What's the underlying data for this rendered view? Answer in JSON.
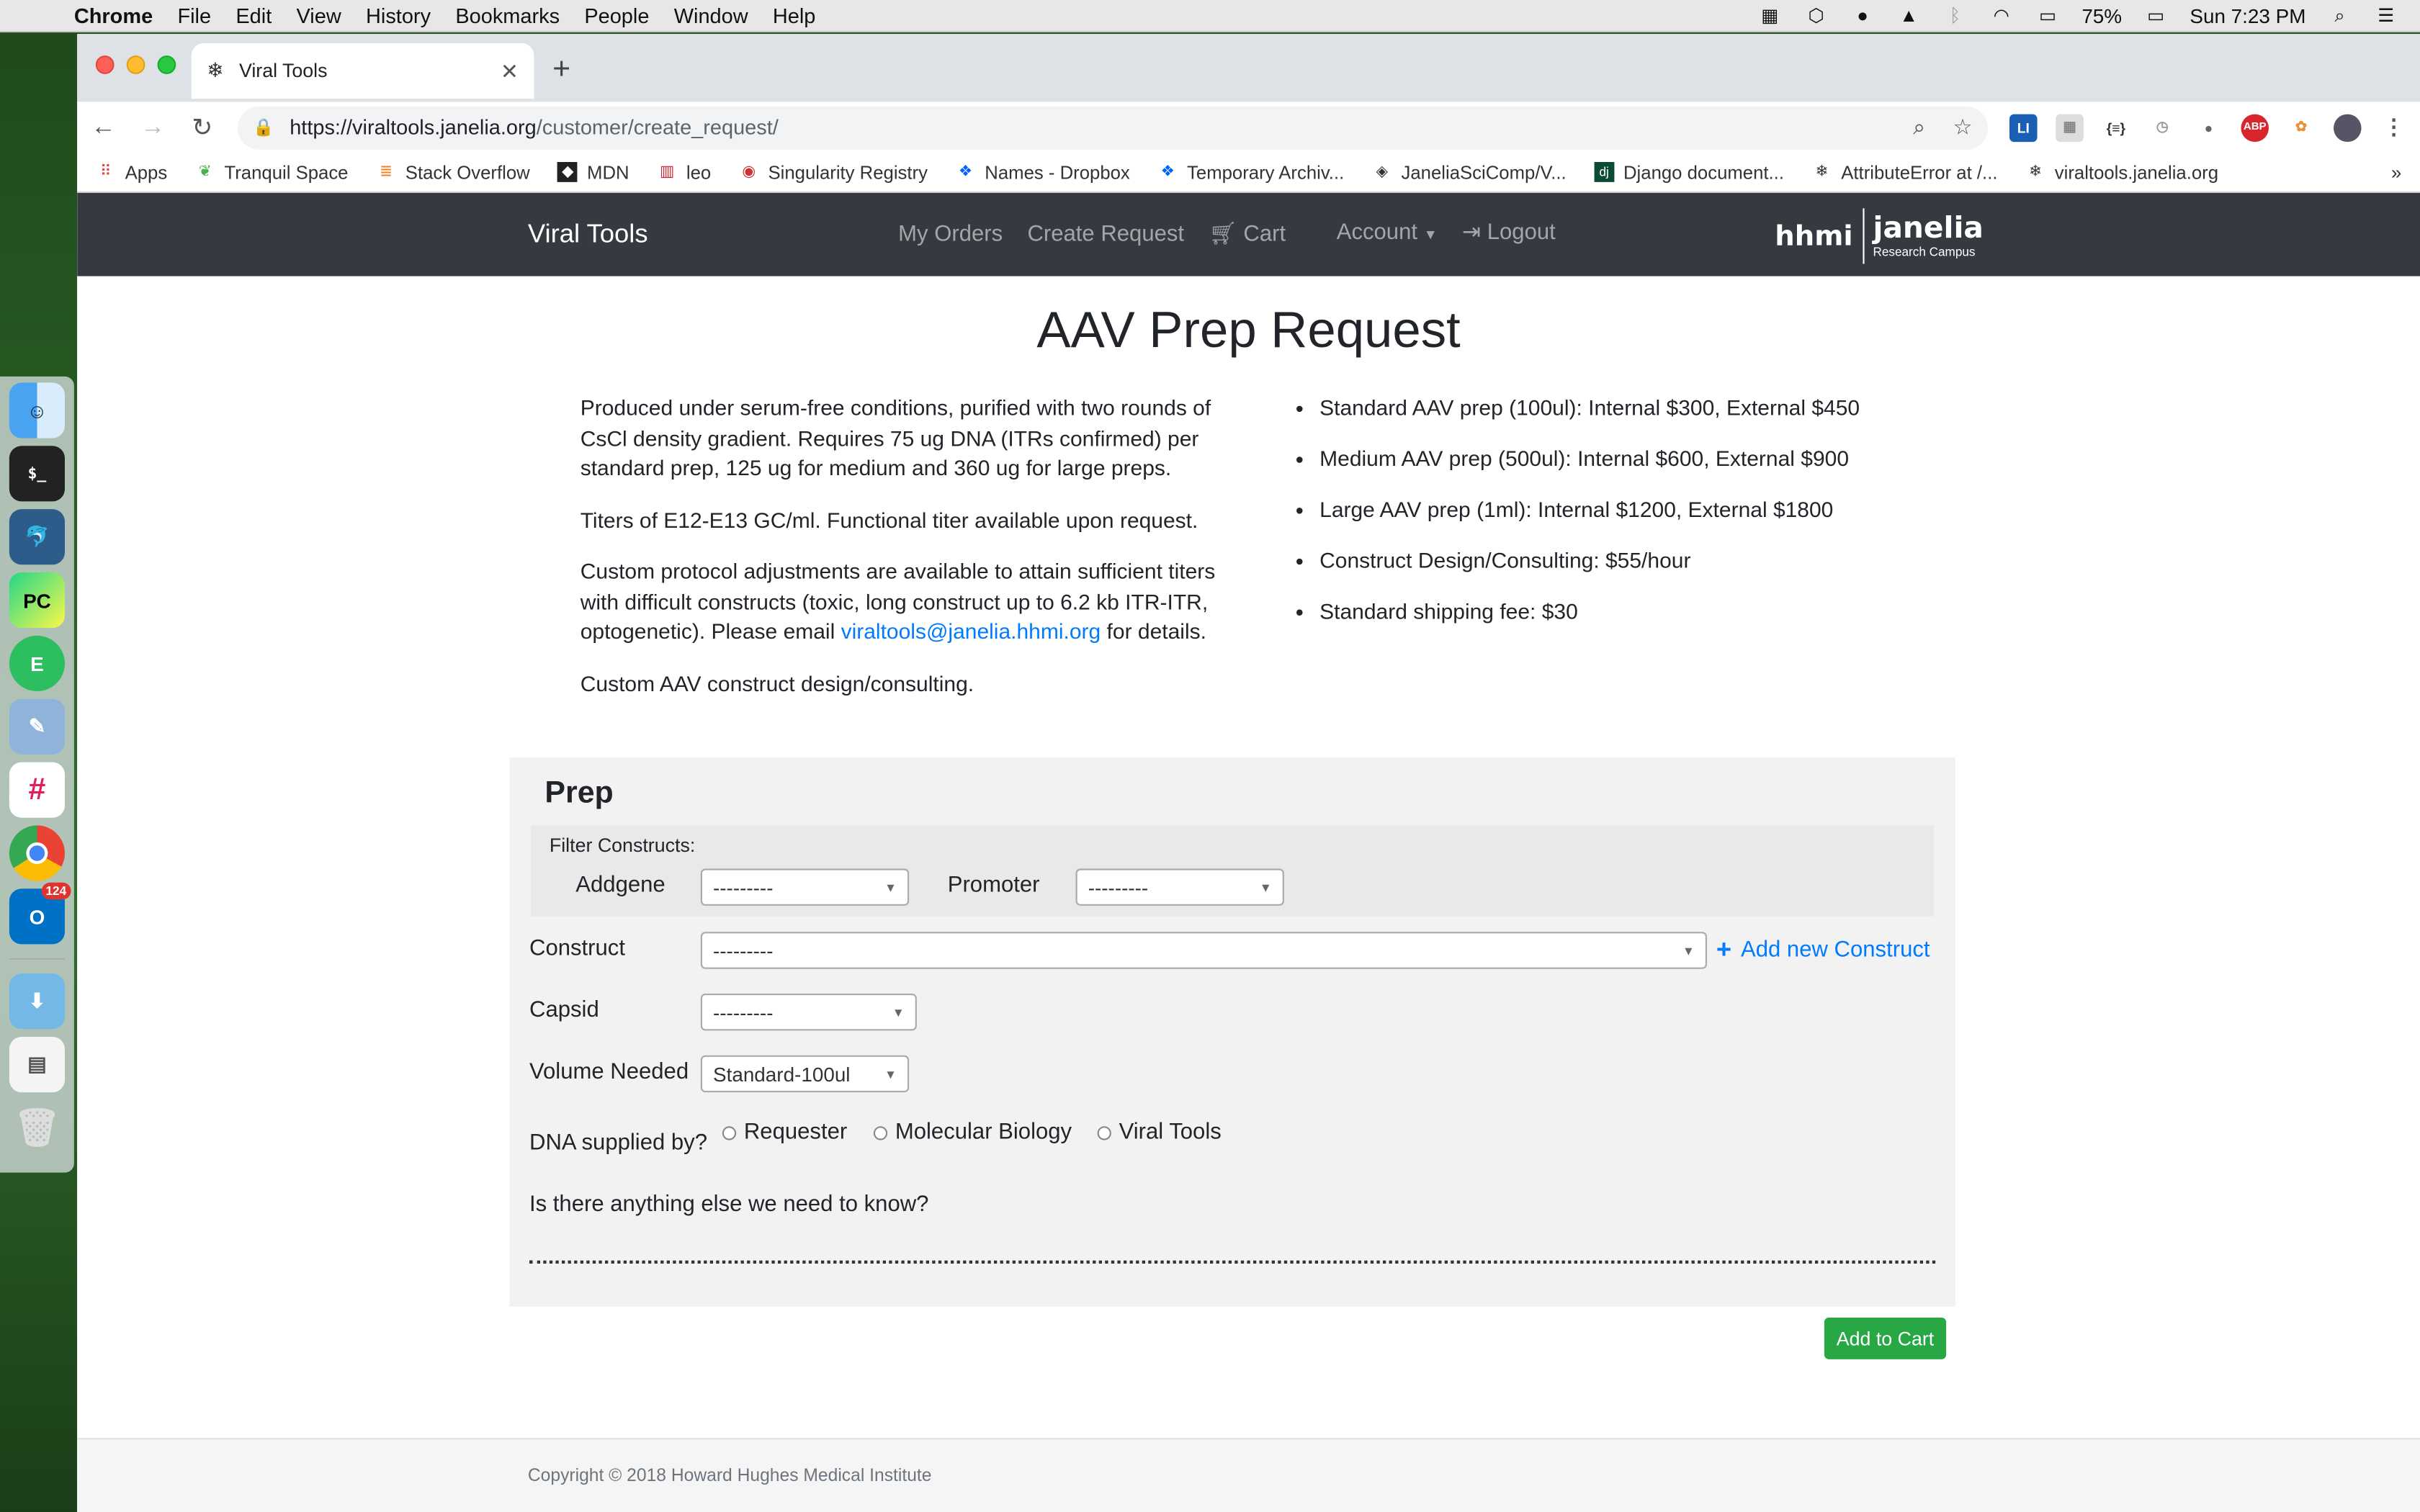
{
  "menubar": {
    "app": "Chrome",
    "items": [
      "File",
      "Edit",
      "View",
      "History",
      "Bookmarks",
      "People",
      "Window",
      "Help"
    ],
    "battery": "75%",
    "clock": "Sun 7:23 PM"
  },
  "dock": {
    "outlook_badge": "124"
  },
  "browser": {
    "tab_title": "Viral Tools",
    "url_host": "https://viraltools.janelia.org",
    "url_path": "/customer/create_request/",
    "bookmarks": [
      "Apps",
      "Tranquil Space",
      "Stack Overflow",
      "MDN",
      "leo",
      "Singularity Registry",
      "Names - Dropbox",
      "Temporary Archiv...",
      "JaneliaSciComp/V...",
      "Django document...",
      "AttributeError at /...",
      "viraltools.janelia.org"
    ],
    "more": "»"
  },
  "navbar": {
    "brand": "Viral Tools",
    "my_orders": "My Orders",
    "create_request": "Create Request",
    "cart": "Cart",
    "account": "Account",
    "logout": "Logout",
    "logo_hhmi": "hhmi",
    "logo_janelia": "janelia",
    "logo_sub": "Research Campus"
  },
  "page": {
    "title": "AAV Prep Request",
    "desc1": "Produced under serum-free conditions, purified with two rounds of CsCl density gradient. Requires 75 ug DNA (ITRs confirmed) per standard prep, 125 ug for medium and 360 ug for large preps.",
    "desc2": "Titers of E12-E13 GC/ml. Functional titer available upon request.",
    "desc3_pre": "Custom protocol adjustments are available to attain sufficient titers with difficult constructs (toxic, long construct up to 6.2 kb ITR-ITR, optogenetic). Please email ",
    "desc3_email": "viraltools@janelia.hhmi.org",
    "desc3_post": " for details.",
    "desc4": "Custom AAV construct design/consulting.",
    "prices": [
      "Standard AAV prep (100ul): Internal $300, External $450",
      "Medium AAV prep (500ul): Internal $600, External $900",
      "Large AAV prep (1ml): Internal $1200, External $1800",
      "Construct Design/Consulting: $55/hour",
      "Standard shipping fee: $30"
    ]
  },
  "form": {
    "heading": "Prep",
    "filter_label": "Filter Constructs:",
    "addgene_label": "Addgene",
    "addgene_value": "---------",
    "promoter_label": "Promoter",
    "promoter_value": "---------",
    "construct_label": "Construct",
    "construct_value": "---------",
    "add_new_construct": "Add new Construct",
    "capsid_label": "Capsid",
    "capsid_value": "---------",
    "volume_label": "Volume Needed",
    "volume_value": "Standard-100ul",
    "dna_label": "DNA supplied by?",
    "dna_options": [
      "Requester",
      "Molecular Biology",
      "Viral Tools"
    ],
    "notes_label": "Is there anything else we need to know?",
    "add_to_cart": "Add to Cart"
  },
  "footer": {
    "copyright": "Copyright © 2018 Howard Hughes Medical Institute"
  }
}
